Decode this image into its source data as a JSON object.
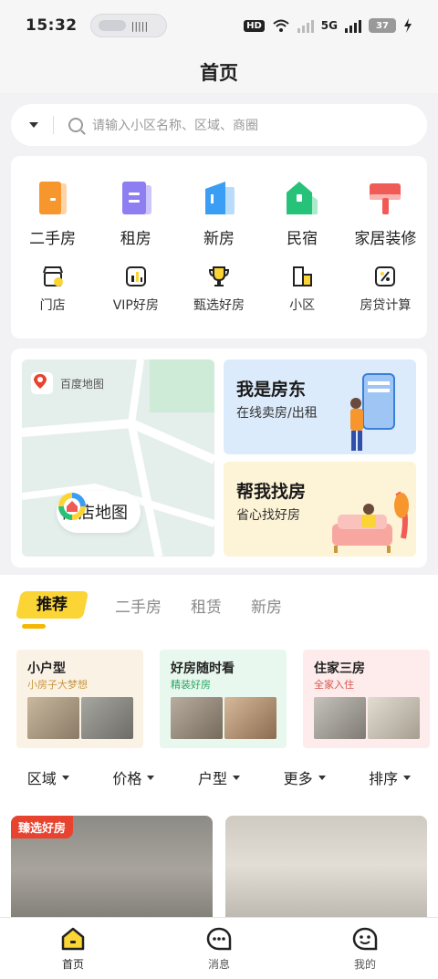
{
  "status_bar": {
    "time": "15:32",
    "hd_label": "HD",
    "net_label": "5G",
    "battery": "37"
  },
  "header": {
    "title": "首页"
  },
  "search": {
    "placeholder": "请输入小区名称、区域、商圈"
  },
  "main_services": [
    {
      "label": "二手房",
      "icon": "orange-house-icon",
      "color": "#f7962d"
    },
    {
      "label": "租房",
      "icon": "purple-doc-icon",
      "color": "#8d7ef2"
    },
    {
      "label": "新房",
      "icon": "blue-building-icon",
      "color": "#3a9ef5"
    },
    {
      "label": "民宿",
      "icon": "green-home-icon",
      "color": "#27c27a"
    },
    {
      "label": "家居装修",
      "icon": "red-brush-icon",
      "color": "#f05b55"
    }
  ],
  "sub_services": [
    {
      "label": "门店",
      "icon": "store-icon"
    },
    {
      "label": "VIP好房",
      "icon": "chart-icon"
    },
    {
      "label": "甄选好房",
      "icon": "trophy-icon"
    },
    {
      "label": "小区",
      "icon": "buildings-icon"
    },
    {
      "label": "房贷计算",
      "icon": "calculator-icon"
    }
  ],
  "promo": {
    "map_source": "百度地图",
    "store_map": "门店地图",
    "landlord_title": "我是房东",
    "landlord_sub": "在线卖房/出租",
    "find_title": "帮我找房",
    "find_sub": "省心找好房"
  },
  "feed_tabs": [
    "推荐",
    "二手房",
    "租赁",
    "新房"
  ],
  "categories": [
    {
      "title": "小户型",
      "subtitle": "小房子大梦想"
    },
    {
      "title": "好房随时看",
      "subtitle": "精装好房"
    },
    {
      "title": "住家三房",
      "subtitle": "全家入住"
    }
  ],
  "filters": [
    "区域",
    "价格",
    "户型",
    "更多",
    "排序"
  ],
  "listings": [
    {
      "badge": "臻选好房"
    },
    {
      "badge": ""
    }
  ],
  "tab_bar": [
    {
      "label": "首页",
      "icon": "home-icon"
    },
    {
      "label": "消息",
      "icon": "message-icon"
    },
    {
      "label": "我的",
      "icon": "profile-icon"
    }
  ],
  "colors": {
    "accent": "#fbd436",
    "badge_red": "#e8432f"
  }
}
